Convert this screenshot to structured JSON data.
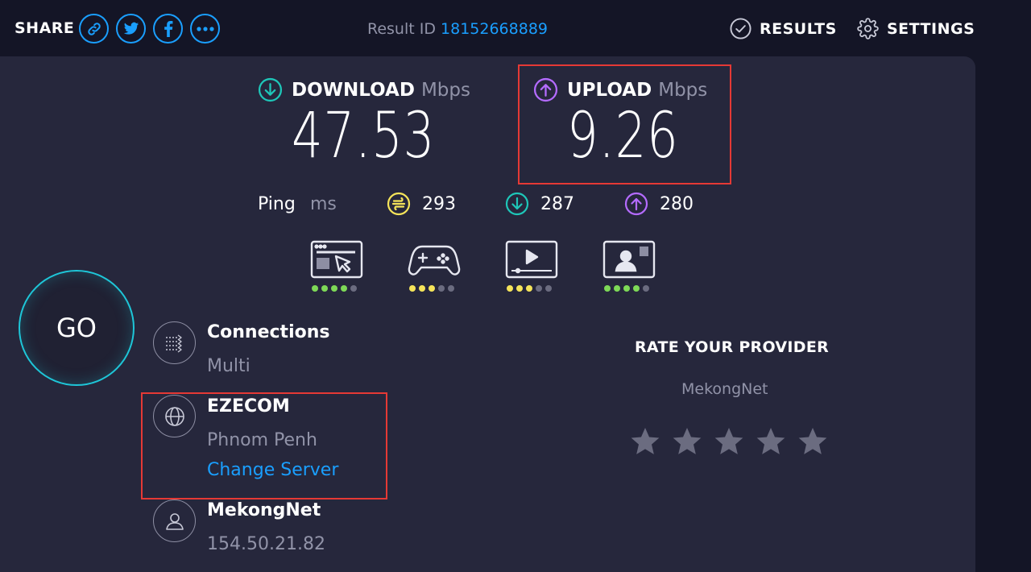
{
  "header": {
    "share_label": "SHARE",
    "share_buttons": [
      "link-icon",
      "twitter-icon",
      "facebook-icon",
      "more-icon"
    ],
    "result_id_label": "Result ID",
    "result_id_value": "18152668889",
    "nav": {
      "results": "RESULTS",
      "settings": "SETTINGS"
    }
  },
  "download": {
    "label": "DOWNLOAD",
    "unit": "Mbps",
    "value": "47.53",
    "color": "#1ec6b8"
  },
  "upload": {
    "label": "UPLOAD",
    "unit": "Mbps",
    "value": "9.26",
    "color": "#b46bff"
  },
  "ping": {
    "label": "Ping",
    "unit": "ms",
    "idle": "293",
    "download": "287",
    "upload": "280",
    "idle_color": "#f5e45a",
    "download_color": "#1ec6b8",
    "upload_color": "#b46bff"
  },
  "activities": [
    {
      "icon": "web-browsing-icon",
      "rating": 4,
      "max": 5,
      "color": "#7ed957"
    },
    {
      "icon": "gaming-icon",
      "rating": 3,
      "max": 5,
      "color": "#f5e45a"
    },
    {
      "icon": "video-streaming-icon",
      "rating": 3,
      "max": 5,
      "color": "#f5e45a"
    },
    {
      "icon": "video-chat-icon",
      "rating": 4,
      "max": 5,
      "color": "#7ed957"
    }
  ],
  "go_label": "GO",
  "connections": {
    "title": "Connections",
    "value": "Multi"
  },
  "server": {
    "name": "EZECOM",
    "location": "Phnom Penh",
    "change_label": "Change Server"
  },
  "provider": {
    "name": "MekongNet",
    "ip": "154.50.21.82"
  },
  "rating": {
    "title": "RATE YOUR PROVIDER",
    "isp": "MekongNet",
    "stars": 5
  }
}
